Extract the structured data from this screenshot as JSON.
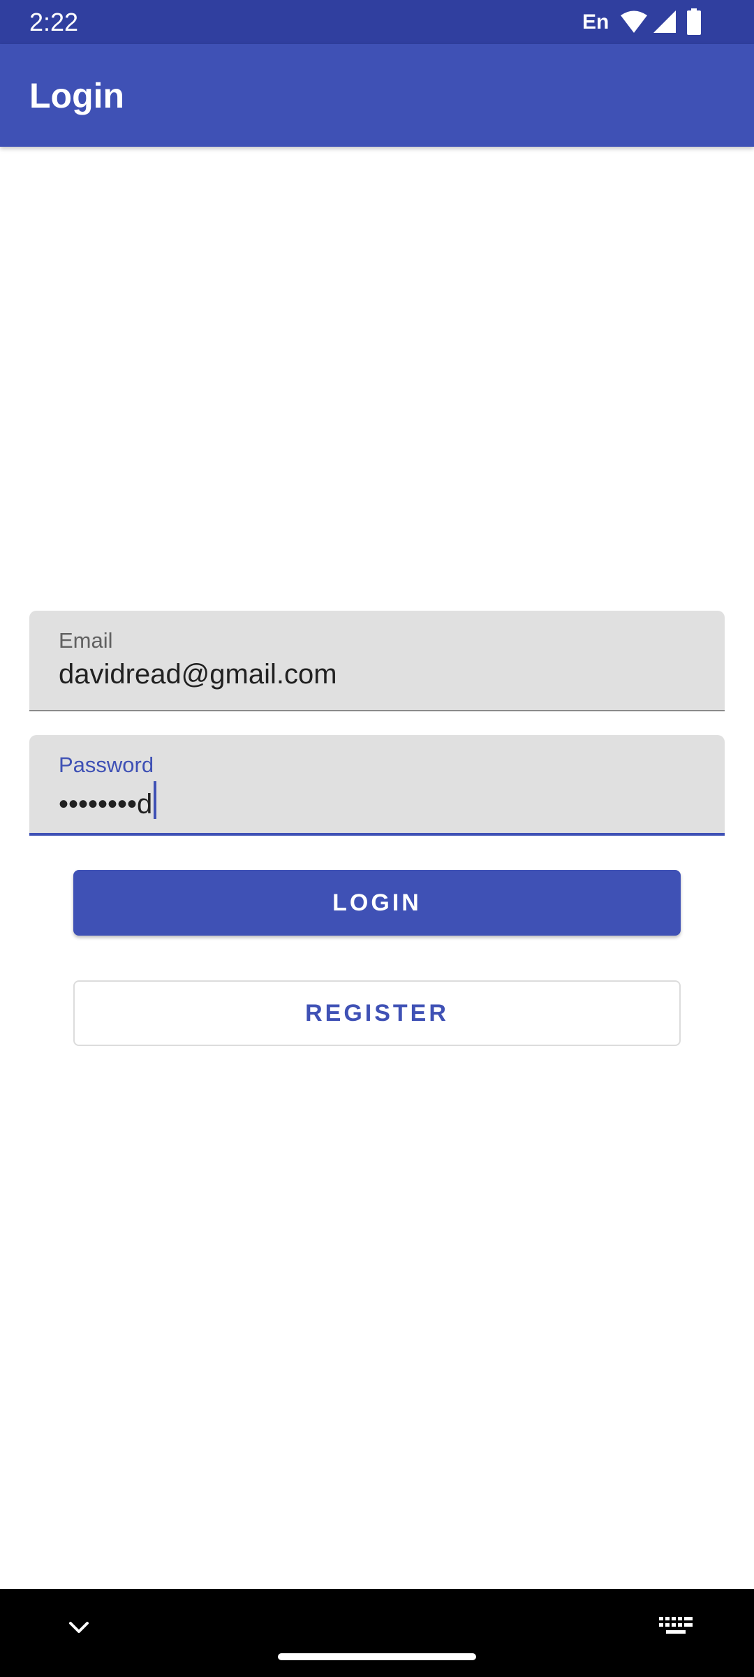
{
  "status_bar": {
    "time": "2:22",
    "language": "En",
    "icons": [
      "wifi-icon",
      "signal-icon",
      "battery-icon"
    ]
  },
  "app_bar": {
    "title": "Login"
  },
  "form": {
    "email": {
      "label": "Email",
      "value": "davidread@gmail.com"
    },
    "password": {
      "label": "Password",
      "value": "••••••••d"
    }
  },
  "buttons": {
    "login": "LOGIN",
    "register": "REGISTER"
  },
  "nav_bar": {
    "icons": [
      "chevron-down-icon",
      "home-handle",
      "keyboard-icon"
    ]
  },
  "colors": {
    "primary": "#3f51b5",
    "primary_dark": "#303f9f",
    "field_background": "#e0e0e0"
  }
}
